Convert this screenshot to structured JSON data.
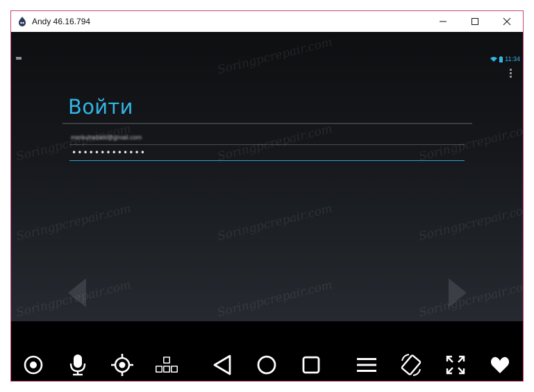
{
  "window": {
    "title": "Andy 46.16.794",
    "controls": [
      "minimize",
      "maximize",
      "close"
    ]
  },
  "status_bar": {
    "time": "11:34",
    "icons": [
      "wifi-icon",
      "battery-icon"
    ]
  },
  "login": {
    "title": "Войти",
    "email_value": "merkuhadatti@gmail.com",
    "password_value": "•••••••••••••"
  },
  "toolbar": {
    "buttons": [
      "camera-icon",
      "microphone-icon",
      "location-icon",
      "keyboard-keys-icon",
      "back-icon",
      "home-icon",
      "recents-icon",
      "menu-icon",
      "rotate-icon",
      "fullscreen-icon",
      "heart-icon"
    ]
  },
  "colors": {
    "accent": "#33b5e5",
    "window_border": "#c6467a",
    "screen_top": "#0e0f11",
    "screen_bottom": "#262a30"
  },
  "watermark": "Soringpcrepair.com"
}
